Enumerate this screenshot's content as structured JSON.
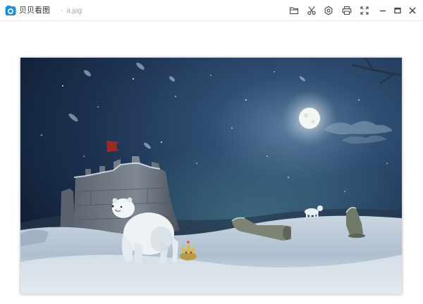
{
  "app": {
    "title": "贝贝看图",
    "logo_icon": "camera-icon",
    "brand_color": "#1a8fe0"
  },
  "file": {
    "separator": "-",
    "name": "a.jpg"
  },
  "toolbar": {
    "buttons": [
      {
        "name": "open-folder",
        "icon": "folder-icon"
      },
      {
        "name": "cut",
        "icon": "scissors-icon"
      },
      {
        "name": "settings",
        "icon": "gear-icon"
      },
      {
        "name": "print",
        "icon": "printer-icon"
      },
      {
        "name": "fullscreen",
        "icon": "fullscreen-icon"
      }
    ]
  },
  "window_controls": [
    {
      "name": "minimize",
      "icon": "minimize-icon"
    },
    {
      "name": "maximize",
      "icon": "maximize-icon"
    },
    {
      "name": "close",
      "icon": "close-icon"
    }
  ],
  "image": {
    "subject": "polar-bear-winter-night-scene"
  }
}
